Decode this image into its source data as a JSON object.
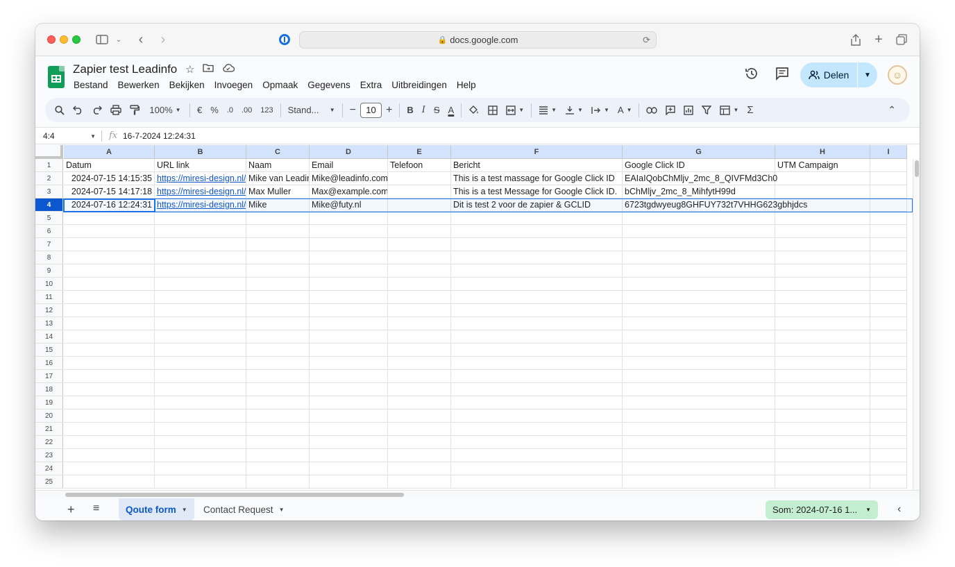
{
  "browser": {
    "url": "docs.google.com"
  },
  "doc": {
    "title": "Zapier test Leadinfo",
    "menu": [
      "Bestand",
      "Bewerken",
      "Bekijken",
      "Invoegen",
      "Opmaak",
      "Gegevens",
      "Extra",
      "Uitbreidingen",
      "Help"
    ],
    "share_label": "Delen"
  },
  "toolbar": {
    "zoom": "100%",
    "currency": "€",
    "percent": "%",
    "dec_decrease": ".0",
    "dec_increase": ".00",
    "number_format": "123",
    "font": "Stand...",
    "font_size": "10",
    "bold": "B",
    "italic": "I",
    "strike": "S",
    "text_color": "A",
    "sum": "Σ"
  },
  "formula": {
    "cell_ref": "4:4",
    "fx": "fx",
    "value": "16-7-2024 12:24:31"
  },
  "sheet": {
    "columns": [
      "A",
      "B",
      "C",
      "D",
      "E",
      "F",
      "G",
      "H",
      "I"
    ],
    "row_numbers": [
      "1",
      "2",
      "3",
      "4",
      "5",
      "6",
      "7",
      "8",
      "9",
      "10",
      "11",
      "12",
      "13",
      "14",
      "15",
      "16",
      "17",
      "18",
      "19",
      "20",
      "21",
      "22",
      "23",
      "24",
      "25"
    ],
    "active_row": "4",
    "rows": [
      [
        "Datum",
        "URL link",
        "Naam",
        "Email",
        "Telefoon",
        "Bericht",
        "Google Click ID",
        "UTM Campaign",
        ""
      ],
      [
        "2024-07-15 14:15:35",
        "https://miresi-design.nl/?",
        "Mike van Leadinfo",
        "Mike@leadinfo.com",
        "",
        "This is a test massage for Google Click ID",
        "EAIaIQobChMljv_2mc_8_QIVFMd3Ch0",
        "",
        ""
      ],
      [
        "2024-07-15 14:17:18",
        "https://miresi-design.nl/?",
        "Max Muller",
        "Max@example.com",
        "",
        "This is a test Message for Google Click ID.",
        "bChMljv_2mc_8_MihfytH99d",
        "",
        ""
      ],
      [
        "2024-07-16 12:24:31",
        "https://miresi-design.nl/?",
        "Mike",
        "Mike@futy.nl",
        "",
        "Dit is test 2 voor de zapier & GCLID",
        "6723tgdwyeug8GHFUY732t7VHHG623gbhjdcs",
        "",
        ""
      ]
    ]
  },
  "tabs": {
    "sheets": [
      "Qoute form",
      "Contact Request"
    ],
    "active": "Qoute form",
    "sum_label": "Som: 2024-07-16 1..."
  },
  "colors": {
    "accent": "#0b57d0",
    "share_bg": "#c2e7ff",
    "sum_bg": "#c4eed0",
    "header_selected": "#d3e3fd",
    "sheets_green": "#0f9d58"
  }
}
